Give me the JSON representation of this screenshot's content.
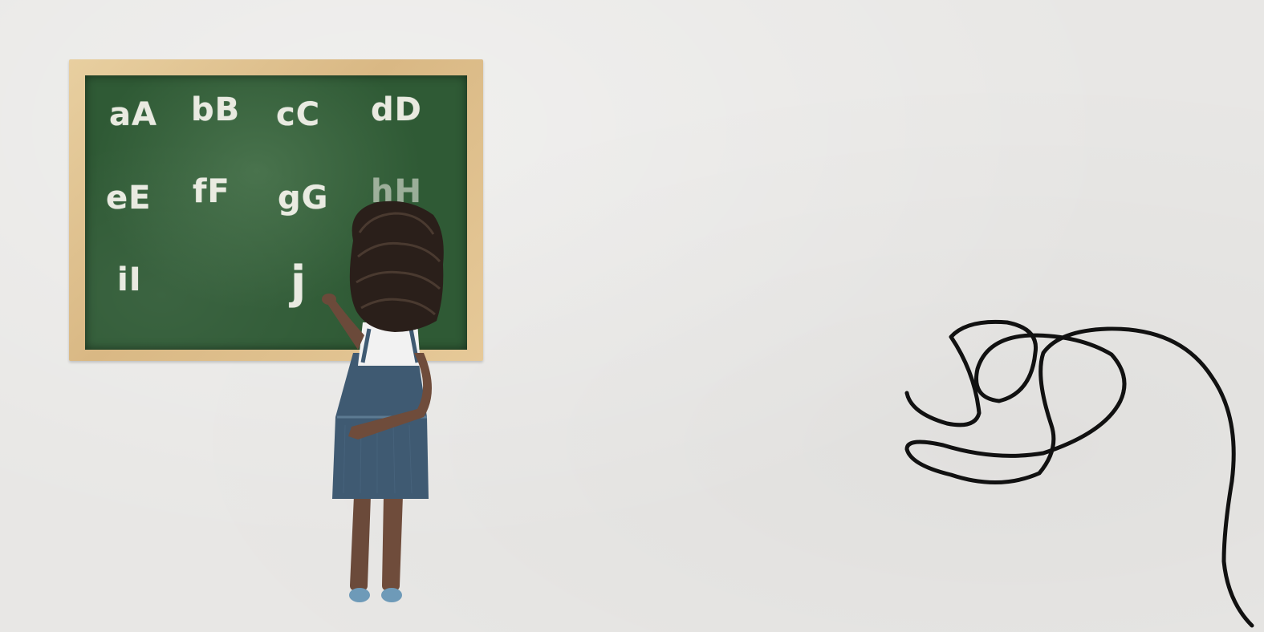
{
  "scene": {
    "description_free": true
  },
  "chalkboard": {
    "rows": [
      [
        "aA",
        "bB",
        "cC",
        "dD"
      ],
      [
        "eE",
        "fF",
        "gG",
        "hH"
      ],
      [
        "iI",
        "",
        "j",
        ""
      ]
    ]
  },
  "colors": {
    "background": "#e8e7e5",
    "board": "#2f5a35",
    "frame": "#d9b884",
    "chalk": "#f3f2ea",
    "scribble": "#111111"
  },
  "icons": {
    "girl": "girl-figure",
    "scribble": "scribble-line"
  }
}
